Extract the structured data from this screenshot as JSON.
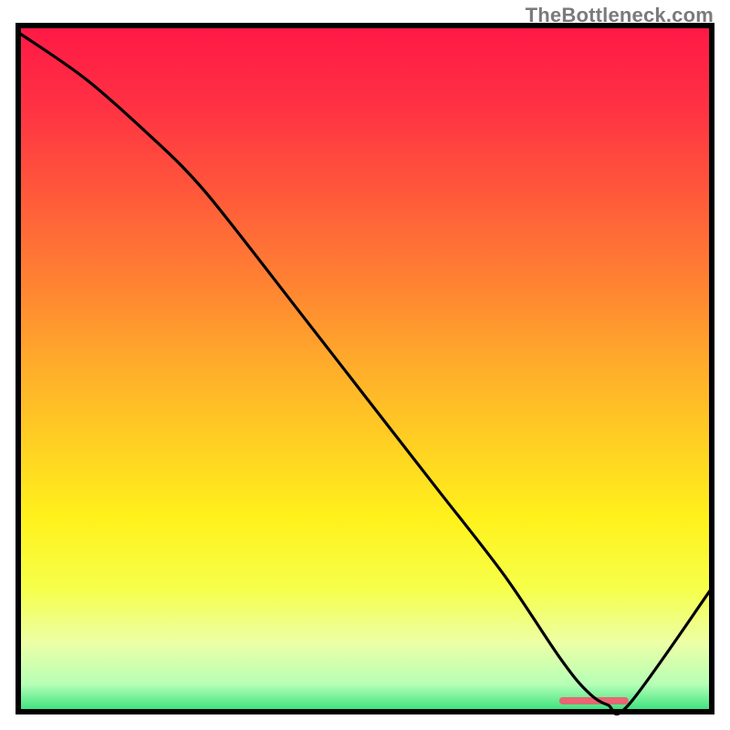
{
  "watermark": "TheBottleneck.com",
  "chart_data": {
    "type": "line",
    "title": "",
    "xlabel": "",
    "ylabel": "",
    "xlim": [
      0,
      100
    ],
    "ylim": [
      0,
      100
    ],
    "grid": false,
    "legend": false,
    "annotations": [],
    "series": [
      {
        "name": "curve",
        "color": "#000000",
        "x": [
          0,
          10,
          20,
          25,
          30,
          40,
          50,
          60,
          70,
          78,
          82,
          85,
          88,
          100
        ],
        "y": [
          99,
          92,
          83,
          78,
          72,
          59,
          46,
          33,
          20,
          8,
          3,
          1,
          1,
          18
        ]
      }
    ],
    "background_gradient": {
      "stops": [
        {
          "offset": 0.0,
          "color": "#ff1846"
        },
        {
          "offset": 0.12,
          "color": "#ff3243"
        },
        {
          "offset": 0.25,
          "color": "#ff5a3a"
        },
        {
          "offset": 0.38,
          "color": "#ff8432"
        },
        {
          "offset": 0.5,
          "color": "#ffae2a"
        },
        {
          "offset": 0.62,
          "color": "#ffd322"
        },
        {
          "offset": 0.72,
          "color": "#fff21c"
        },
        {
          "offset": 0.82,
          "color": "#f6ff4a"
        },
        {
          "offset": 0.9,
          "color": "#ecffa6"
        },
        {
          "offset": 0.96,
          "color": "#b6ffb6"
        },
        {
          "offset": 1.0,
          "color": "#33e07a"
        }
      ]
    },
    "bottom_strip": {
      "x_start": 78,
      "x_end": 88,
      "color": "#ff4d6d",
      "alpha": 0.85
    }
  },
  "plot_geometry": {
    "outer_w": 800,
    "outer_h": 800,
    "inner_x": 20,
    "inner_y": 28,
    "inner_w": 760,
    "inner_h": 752,
    "frame_stroke": "#000000",
    "frame_stroke_width": 6
  }
}
